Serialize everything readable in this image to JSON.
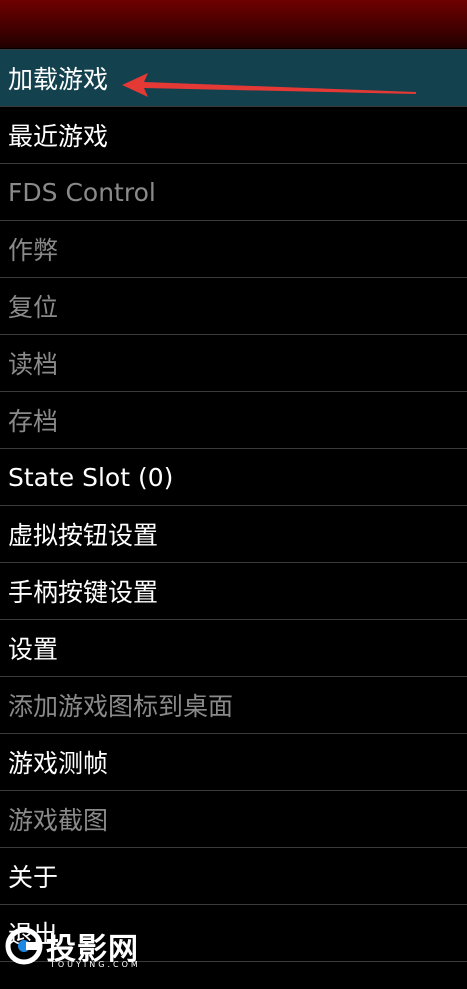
{
  "menu": {
    "items": [
      {
        "label": "加载游戏",
        "enabled": true,
        "selected": true
      },
      {
        "label": "最近游戏",
        "enabled": true
      },
      {
        "label": "FDS Control",
        "enabled": false
      },
      {
        "label": "作弊",
        "enabled": false
      },
      {
        "label": "复位",
        "enabled": false
      },
      {
        "label": "读档",
        "enabled": false
      },
      {
        "label": "存档",
        "enabled": false
      },
      {
        "label": "State Slot (0)",
        "enabled": true
      },
      {
        "label": "虚拟按钮设置",
        "enabled": true
      },
      {
        "label": "手柄按键设置",
        "enabled": true
      },
      {
        "label": "设置",
        "enabled": true
      },
      {
        "label": "添加游戏图标到桌面",
        "enabled": false
      },
      {
        "label": "游戏测帧",
        "enabled": true
      },
      {
        "label": "游戏截图",
        "enabled": false
      },
      {
        "label": "关于",
        "enabled": true
      },
      {
        "label": "退出",
        "enabled": true
      }
    ]
  },
  "watermark": {
    "name": "投影网",
    "domain": "TOUYING.COM"
  },
  "colors": {
    "header": "#3a0000",
    "selected_row": "#14414e",
    "enabled_text": "#ffffff",
    "disabled_text": "#8a8a8a",
    "annotation_arrow": "#e53935"
  }
}
